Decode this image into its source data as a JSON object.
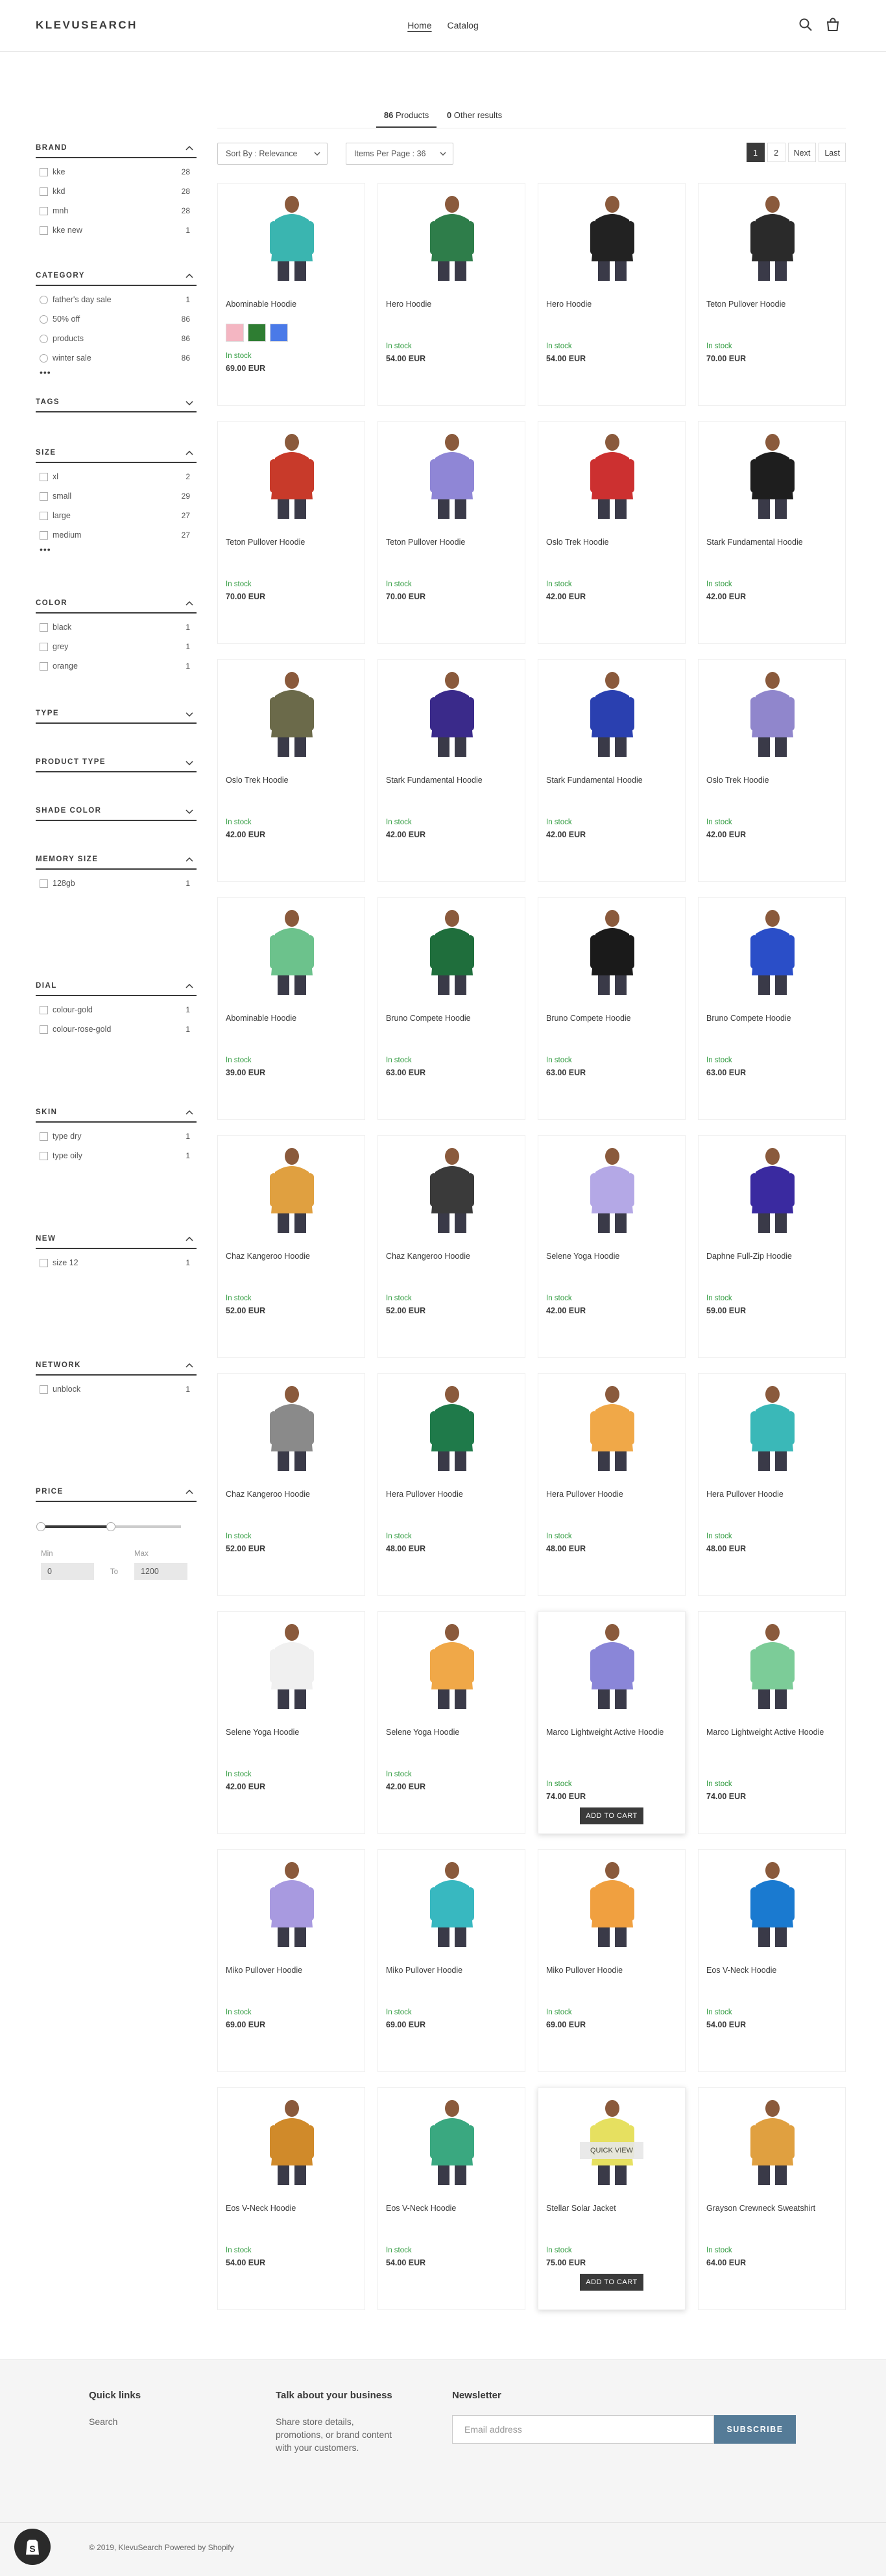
{
  "header": {
    "logo": "KLEVUSEARCH",
    "nav": [
      "Home",
      "Catalog"
    ],
    "icons": [
      "search-icon",
      "cart-icon"
    ]
  },
  "tabs": [
    {
      "count": "86",
      "label": "Products"
    },
    {
      "count": "0",
      "label": "Other results"
    }
  ],
  "toolbar": {
    "sort_label": "Sort By : Relevance",
    "per_page_label": "Items Per Page : 36",
    "pages": [
      "1",
      "2",
      "Next",
      "Last"
    ],
    "current_page": "1"
  },
  "filters": [
    {
      "title": "BRAND",
      "expanded": true,
      "type": "checkbox",
      "options": [
        {
          "label": "kke",
          "count": "28"
        },
        {
          "label": "kkd",
          "count": "28"
        },
        {
          "label": "mnh",
          "count": "28"
        },
        {
          "label": "kke new",
          "count": "1"
        }
      ]
    },
    {
      "title": "CATEGORY",
      "expanded": true,
      "type": "radio",
      "more": "•••",
      "options": [
        {
          "label": "father's day sale",
          "count": "1"
        },
        {
          "label": "50% off",
          "count": "86"
        },
        {
          "label": "products",
          "count": "86"
        },
        {
          "label": "winter sale",
          "count": "86"
        }
      ]
    },
    {
      "title": "TAGS",
      "expanded": false,
      "options": []
    },
    {
      "title": "SIZE",
      "expanded": true,
      "type": "checkbox",
      "more": "•••",
      "options": [
        {
          "label": "xl",
          "count": "2"
        },
        {
          "label": "small",
          "count": "29"
        },
        {
          "label": "large",
          "count": "27"
        },
        {
          "label": "medium",
          "count": "27"
        }
      ]
    },
    {
      "title": "COLOR",
      "expanded": true,
      "type": "checkbox",
      "options": [
        {
          "label": "black",
          "count": "1"
        },
        {
          "label": "grey",
          "count": "1"
        },
        {
          "label": "orange",
          "count": "1"
        }
      ]
    },
    {
      "title": "TYPE",
      "expanded": false,
      "options": []
    },
    {
      "title": "PRODUCT TYPE",
      "expanded": false,
      "options": []
    },
    {
      "title": "SHADE COLOR",
      "expanded": false,
      "options": []
    },
    {
      "title": "MEMORY SIZE",
      "expanded": true,
      "type": "checkbox",
      "options": [
        {
          "label": "128gb",
          "count": "1"
        }
      ]
    },
    {
      "title": "DIAL",
      "expanded": true,
      "type": "checkbox",
      "options": [
        {
          "label": "colour-gold",
          "count": "1"
        },
        {
          "label": "colour-rose-gold",
          "count": "1"
        }
      ]
    },
    {
      "title": "SKIN",
      "expanded": true,
      "type": "checkbox",
      "options": [
        {
          "label": "type dry",
          "count": "1"
        },
        {
          "label": "type oily",
          "count": "1"
        }
      ]
    },
    {
      "title": "NEW",
      "expanded": true,
      "type": "checkbox",
      "options": [
        {
          "label": "size 12",
          "count": "1"
        }
      ]
    },
    {
      "title": "NETWORK",
      "expanded": true,
      "type": "checkbox",
      "options": [
        {
          "label": "unblock",
          "count": "1"
        }
      ]
    }
  ],
  "price_filter": {
    "title": "PRICE",
    "min_label": "Min",
    "max_label": "Max",
    "min": "0",
    "max": "1200",
    "to": "To",
    "slider_low": 0,
    "slider_high": 0.5
  },
  "products": [
    {
      "name": "Abominable Hoodie",
      "stock": "In stock",
      "price": "69.00 EUR",
      "color": "#3ab5b0",
      "swatches": [
        "#f4b6c2",
        "#2e7d32",
        "#4a7ae8"
      ]
    },
    {
      "name": "Hero Hoodie",
      "stock": "In stock",
      "price": "54.00 EUR",
      "color": "#2e7d4a"
    },
    {
      "name": "Hero Hoodie",
      "stock": "In stock",
      "price": "54.00 EUR",
      "color": "#222222"
    },
    {
      "name": "Teton Pullover Hoodie",
      "stock": "In stock",
      "price": "70.00 EUR",
      "color": "#2a2a2a"
    },
    {
      "name": "Teton Pullover Hoodie",
      "stock": "In stock",
      "price": "70.00 EUR",
      "color": "#c83a2a"
    },
    {
      "name": "Teton Pullover Hoodie",
      "stock": "In stock",
      "price": "70.00 EUR",
      "color": "#8f86d6"
    },
    {
      "name": "Oslo Trek Hoodie",
      "stock": "In stock",
      "price": "42.00 EUR",
      "color": "#cc3030"
    },
    {
      "name": "Stark Fundamental Hoodie",
      "stock": "In stock",
      "price": "42.00 EUR",
      "color": "#1e1e1e"
    },
    {
      "name": "Oslo Trek Hoodie",
      "stock": "In stock",
      "price": "42.00 EUR",
      "color": "#6b6a4a"
    },
    {
      "name": "Stark Fundamental Hoodie",
      "stock": "In stock",
      "price": "42.00 EUR",
      "color": "#3a2a8a"
    },
    {
      "name": "Stark Fundamental Hoodie",
      "stock": "In stock",
      "price": "42.00 EUR",
      "color": "#2a40b0"
    },
    {
      "name": "Oslo Trek Hoodie",
      "stock": "In stock",
      "price": "42.00 EUR",
      "color": "#9086cc"
    },
    {
      "name": "Abominable Hoodie",
      "stock": "In stock",
      "price": "39.00 EUR",
      "color": "#6cc28c"
    },
    {
      "name": "Bruno Compete Hoodie",
      "stock": "In stock",
      "price": "63.00 EUR",
      "color": "#1f6e3c"
    },
    {
      "name": "Bruno Compete Hoodie",
      "stock": "In stock",
      "price": "63.00 EUR",
      "color": "#1a1a1a"
    },
    {
      "name": "Bruno Compete Hoodie",
      "stock": "In stock",
      "price": "63.00 EUR",
      "color": "#2a4ec8"
    },
    {
      "name": "Chaz Kangeroo Hoodie",
      "stock": "In stock",
      "price": "52.00 EUR",
      "color": "#e0a040"
    },
    {
      "name": "Chaz Kangeroo Hoodie",
      "stock": "In stock",
      "price": "52.00 EUR",
      "color": "#3a3a3a"
    },
    {
      "name": "Selene Yoga Hoodie",
      "stock": "In stock",
      "price": "42.00 EUR",
      "color": "#b4a8e6"
    },
    {
      "name": "Daphne Full-Zip Hoodie",
      "stock": "In stock",
      "price": "59.00 EUR",
      "color": "#3a2aa0"
    },
    {
      "name": "Chaz Kangeroo Hoodie",
      "stock": "In stock",
      "price": "52.00 EUR",
      "color": "#8a8a8a"
    },
    {
      "name": "Hera Pullover Hoodie",
      "stock": "In stock",
      "price": "48.00 EUR",
      "color": "#1f7a4a"
    },
    {
      "name": "Hera Pullover Hoodie",
      "stock": "In stock",
      "price": "48.00 EUR",
      "color": "#f0a848"
    },
    {
      "name": "Hera Pullover Hoodie",
      "stock": "In stock",
      "price": "48.00 EUR",
      "color": "#3ab8b8"
    },
    {
      "name": "Selene Yoga Hoodie",
      "stock": "In stock",
      "price": "42.00 EUR",
      "color": "#f0f0f0"
    },
    {
      "name": "Selene Yoga Hoodie",
      "stock": "In stock",
      "price": "42.00 EUR",
      "color": "#f0a848"
    },
    {
      "name": "Marco Lightweight Active Hoodie",
      "stock": "In stock",
      "price": "74.00 EUR",
      "color": "#8a86d8",
      "hover": true
    },
    {
      "name": "Marco Lightweight Active Hoodie",
      "stock": "In stock",
      "price": "74.00 EUR",
      "color": "#7ccc98"
    },
    {
      "name": "Miko Pullover Hoodie",
      "stock": "In stock",
      "price": "69.00 EUR",
      "color": "#a89ae0"
    },
    {
      "name": "Miko Pullover Hoodie",
      "stock": "In stock",
      "price": "69.00 EUR",
      "color": "#38b8c0"
    },
    {
      "name": "Miko Pullover Hoodie",
      "stock": "In stock",
      "price": "69.00 EUR",
      "color": "#f0a040"
    },
    {
      "name": "Eos V-Neck Hoodie",
      "stock": "In stock",
      "price": "54.00 EUR",
      "color": "#1a7ad0"
    },
    {
      "name": "Eos V-Neck Hoodie",
      "stock": "In stock",
      "price": "54.00 EUR",
      "color": "#d08a2a"
    },
    {
      "name": "Eos V-Neck Hoodie",
      "stock": "In stock",
      "price": "54.00 EUR",
      "color": "#3aa880"
    },
    {
      "name": "Stellar Solar Jacket",
      "stock": "In stock",
      "price": "75.00 EUR",
      "color": "#e6e060",
      "hover": true,
      "quick_view": true
    },
    {
      "name": "Grayson Crewneck Sweatshirt",
      "stock": "In stock",
      "price": "64.00 EUR",
      "color": "#e0a040"
    }
  ],
  "card_actions": {
    "add_to_cart": "ADD TO CART",
    "quick_view": "QUICK VIEW"
  },
  "footer": {
    "quick_links_title": "Quick links",
    "quick_links": [
      "Search"
    ],
    "about_title": "Talk about your business",
    "about_text": "Share store details, promotions, or brand content with your customers.",
    "newsletter_title": "Newsletter",
    "email_placeholder": "Email address",
    "subscribe_label": "SUBSCRIBE",
    "copyright": "© 2019, KlevuSearch Powered by Shopify"
  }
}
